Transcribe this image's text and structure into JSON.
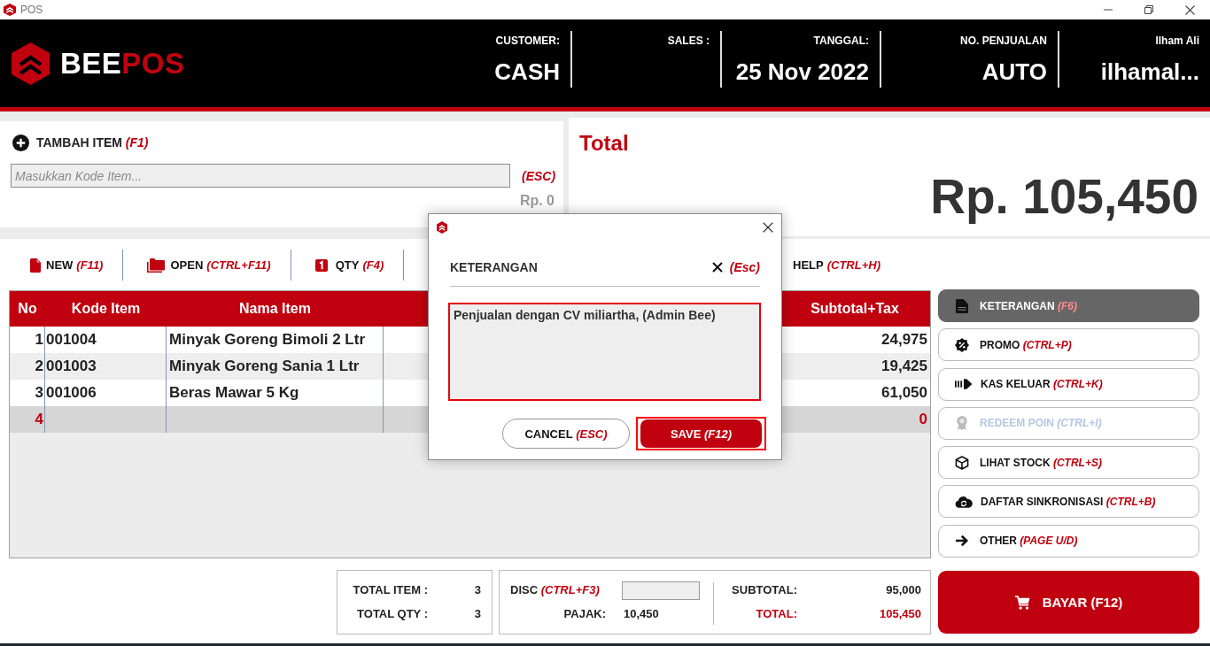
{
  "window": {
    "title": "POS"
  },
  "header": {
    "logo": {
      "lead": "BEE",
      "accent": "POS"
    },
    "fields": [
      {
        "label": "CUSTOMER:",
        "value": "CASH"
      },
      {
        "label": "SALES :"
      },
      {
        "label": "TANGGAL:",
        "value": "25 Nov 2022"
      },
      {
        "label": "NO. PENJUALAN",
        "value": "AUTO"
      },
      {
        "label": "Ilham Ali",
        "value": "ilhamal..."
      }
    ]
  },
  "item_entry": {
    "title": "TAMBAH ITEM",
    "shortcut": "(F1)",
    "placeholder": "Masukkan Kode Item...",
    "clear_hint": "(ESC)",
    "price": "Rp. 0"
  },
  "total_panel": {
    "title": "Total",
    "amount": "Rp. 105,450"
  },
  "toolbar": [
    {
      "label": "NEW",
      "shortcut": "(F11)"
    },
    {
      "label": "OPEN",
      "shortcut": "(CTRL+F11)"
    },
    {
      "label": "QTY",
      "shortcut": "(F4)"
    },
    {
      "label": "HELP",
      "shortcut": "(CTRL+H)"
    }
  ],
  "table": {
    "columns": [
      "No",
      "Kode Item",
      "Nama Item",
      "Subtotal+Tax"
    ],
    "rows": [
      {
        "no": "1",
        "code": "001004",
        "name": "Minyak Goreng Bimoli 2 Ltr",
        "subtotal": "24,975",
        "selected": false
      },
      {
        "no": "2",
        "code": "001003",
        "name": "Minyak Goreng Sania 1 Ltr",
        "subtotal": "19,425",
        "selected": false
      },
      {
        "no": "3",
        "code": "001006",
        "name": "Beras Mawar 5 Kg",
        "subtotal": "61,050",
        "selected": false
      },
      {
        "no": "4",
        "subtotal": "0",
        "selected": true
      }
    ]
  },
  "summary": {
    "counts": [
      {
        "label": "TOTAL ITEM :",
        "value": "3"
      },
      {
        "label": "TOTAL QTY :",
        "value": "3"
      }
    ],
    "discount": {
      "label": "DISC",
      "shortcut": "(CTRL+F3)"
    },
    "tax": {
      "label": "PAJAK:",
      "value": "10,450"
    },
    "totals": [
      {
        "kind": "subtotal",
        "label": "SUBTOTAL:",
        "value": "95,000"
      },
      {
        "kind": "grand",
        "label": "TOTAL:",
        "value": "105,450"
      }
    ]
  },
  "side_actions": [
    {
      "label": "KETERANGAN",
      "shortcut": "(F6)",
      "selected": true,
      "disabled": false
    },
    {
      "label": "PROMO",
      "shortcut": "(CTRL+P)",
      "selected": false,
      "disabled": false
    },
    {
      "label": "KAS KELUAR",
      "shortcut": "(CTRL+K)",
      "selected": false,
      "disabled": false
    },
    {
      "label": "REDEEM POIN",
      "shortcut": "(CTRL+I)",
      "selected": false,
      "disabled": true
    },
    {
      "label": "LIHAT STOCK",
      "shortcut": "(CTRL+S)",
      "selected": false,
      "disabled": false
    },
    {
      "label": "DAFTAR SINKRONISASI",
      "shortcut": "(CTRL+B)",
      "selected": false,
      "disabled": false
    },
    {
      "label": "OTHER",
      "shortcut": "(PAGE U/D)",
      "selected": false,
      "disabled": false
    }
  ],
  "pay_button": {
    "label": "BAYAR (F12)"
  },
  "dialog": {
    "title": "KETERANGAN",
    "close_hint": "(Esc)",
    "note": "Penjualan dengan CV miliartha, (Admin Bee)",
    "buttons": [
      {
        "kind": "secondary",
        "label": "CANCEL",
        "shortcut": "(ESC)",
        "focused": false
      },
      {
        "kind": "primary",
        "label": "SAVE",
        "shortcut": "(F12)",
        "focused": true
      }
    ]
  }
}
